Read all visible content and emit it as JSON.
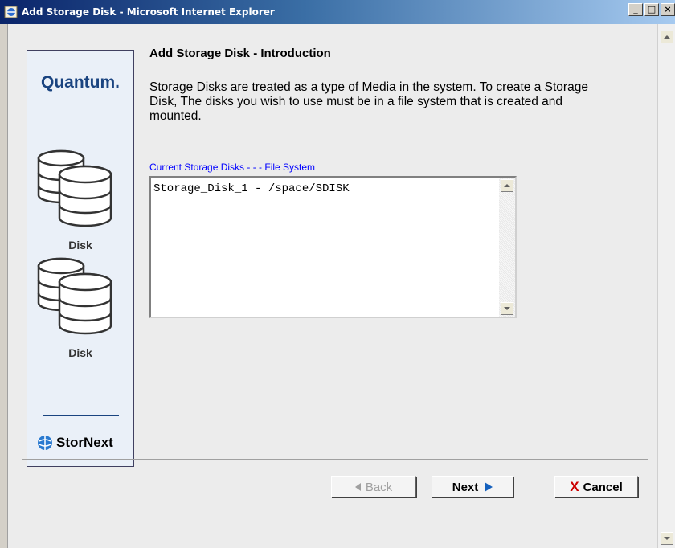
{
  "window": {
    "title": "Add Storage Disk - Microsoft Internet Explorer",
    "minimize_glyph": "_",
    "maximize_glyph": "□",
    "close_glyph": "×"
  },
  "branding": {
    "logo_text": "Quantum.",
    "disk_label_1": "Disk",
    "disk_label_2": "Disk",
    "product_name": "StorNext"
  },
  "main": {
    "heading": "Add Storage Disk - Introduction",
    "intro_text": "Storage Disks are treated as a type of Media in the system. To create a Storage Disk, The disks you wish to use must be in a file system that is created and mounted.",
    "list_label": "Current Storage Disks - - - File System",
    "list_items": [
      "Storage_Disk_1 - /space/SDISK"
    ]
  },
  "buttons": {
    "back_label": "Back",
    "next_label": "Next",
    "cancel_label": "Cancel",
    "cancel_glyph": "X"
  },
  "colors": {
    "titlebar_start": "#0a246a",
    "brand_blue": "#1a4480",
    "link_blue": "#0000ff",
    "next_arrow": "#1560bd",
    "cancel_x": "#cc0000"
  }
}
